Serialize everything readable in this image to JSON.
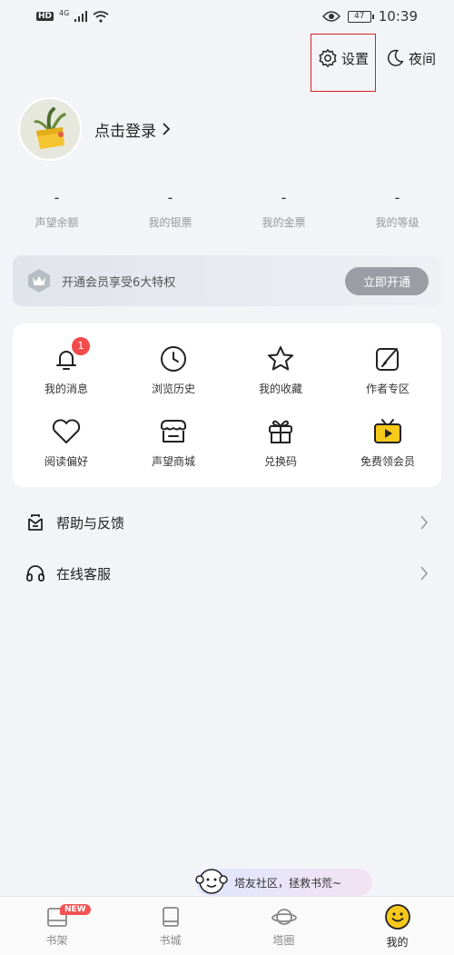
{
  "status_bar": {
    "hd": "HD",
    "network": "4G",
    "battery": "47",
    "time": "10:39"
  },
  "top_actions": {
    "settings_label": "设置",
    "night_label": "夜间"
  },
  "profile": {
    "login_label": "点击登录"
  },
  "stats": [
    {
      "value": "-",
      "label": "声望余额"
    },
    {
      "value": "-",
      "label": "我的银票"
    },
    {
      "value": "-",
      "label": "我的金票"
    },
    {
      "value": "-",
      "label": "我的等级"
    }
  ],
  "vip": {
    "text": "开通会员享受6大特权",
    "button": "立即开通"
  },
  "grid": [
    {
      "label": "我的消息",
      "icon": "bell-icon",
      "badge": "1"
    },
    {
      "label": "浏览历史",
      "icon": "clock-icon"
    },
    {
      "label": "我的收藏",
      "icon": "star-icon"
    },
    {
      "label": "作者专区",
      "icon": "edit-icon"
    },
    {
      "label": "阅读偏好",
      "icon": "heart-icon"
    },
    {
      "label": "声望商城",
      "icon": "store-icon"
    },
    {
      "label": "兑换码",
      "icon": "gift-icon"
    },
    {
      "label": "免费领会员",
      "icon": "tv-play-icon"
    }
  ],
  "list": [
    {
      "label": "帮助与反馈",
      "icon": "feedback-icon"
    },
    {
      "label": "在线客服",
      "icon": "headset-icon"
    }
  ],
  "bubble": {
    "text": "塔友社区，拯救书荒~"
  },
  "tabs": [
    {
      "label": "书架",
      "icon": "bookshelf-icon",
      "badge": "NEW"
    },
    {
      "label": "书城",
      "icon": "book-icon"
    },
    {
      "label": "塔圈",
      "icon": "planet-icon"
    },
    {
      "label": "我的",
      "icon": "smile-icon",
      "active": true
    }
  ],
  "colors": {
    "accent_yellow": "#f7c91a",
    "badge_red": "#f24b4b",
    "highlight_box": "#d62222"
  }
}
